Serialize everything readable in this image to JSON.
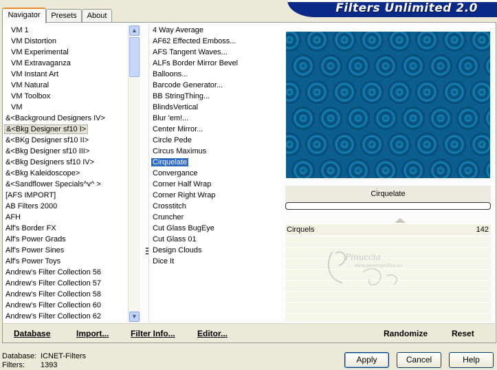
{
  "app": {
    "title": "Filters Unlimited 2.0"
  },
  "tabs": [
    {
      "label": "Navigator",
      "active": true
    },
    {
      "label": "Presets",
      "active": false
    },
    {
      "label": "About",
      "active": false
    }
  ],
  "categories": [
    "VM 1",
    "VM Distortion",
    "VM Experimental",
    "VM Extravaganza",
    "VM Instant Art",
    "VM Natural",
    "VM Toolbox",
    "VM",
    "&<Background Designers IV>",
    "&<Bkg Designer sf10 I>",
    "&<BKg Designer sf10 II>",
    "&<Bkg Designer sf10 III>",
    "&<Bkg Designers sf10 IV>",
    "&<Bkg Kaleidoscope>",
    "&<Sandflower Specials^v^ >",
    "[AFS IMPORT]",
    "AB Filters 2000",
    "AFH",
    "Alf's Border FX",
    "Alf's Power Grads",
    "Alf's Power Sines",
    "Alf's Power Toys",
    "Andrew's Filter Collection 56",
    "Andrew's Filter Collection 57",
    "Andrew's Filter Collection 58",
    "Andrew's Filter Collection 60",
    "Andrew's Filter Collection 62"
  ],
  "selected_category_index": 9,
  "filters": [
    "4 Way Average",
    "AF62 Effected Emboss...",
    "AFS Tangent Waves...",
    "ALFs Border Mirror Bevel",
    "Balloons...",
    "Barcode Generator...",
    "BB StringThing...",
    "BlindsVertical",
    "Blur 'em!...",
    "Center Mirror...",
    "Circle Pede",
    "Circus Maximus",
    "Cirquelate",
    "Convergance",
    "Corner Half Wrap",
    "Corner Right Wrap",
    "Crosstitch",
    "Cruncher",
    "Cut Glass  BugEye",
    "Cut Glass 01",
    "Design Clouds",
    "Dice It"
  ],
  "selected_filter_index": 12,
  "preview": {
    "colors": {
      "base": "#0b5f8e",
      "light": "#1b9fd6",
      "dark": "#063a60"
    }
  },
  "params": {
    "filter_name": "Cirquelate",
    "slider": {
      "label": "Cirquels",
      "value": "142",
      "max": 255
    }
  },
  "watermark": {
    "text": "Pinuccia",
    "subtext": "www.aerocragrafica.eu"
  },
  "toolbar": {
    "database": "Database",
    "import": "Import...",
    "filter_info": "Filter Info...",
    "editor": "Editor...",
    "randomize": "Randomize",
    "reset": "Reset"
  },
  "status": {
    "database_label": "Database:",
    "database_value": "ICNET-Filters",
    "filters_label": "Filters:",
    "filters_value": "1393"
  },
  "buttons": {
    "apply": "Apply",
    "cancel": "Cancel",
    "help": "Help"
  },
  "colors": {
    "accent": "#316ac5",
    "banner": "#0a2a8a",
    "tab_highlight": "#e68b2c"
  }
}
